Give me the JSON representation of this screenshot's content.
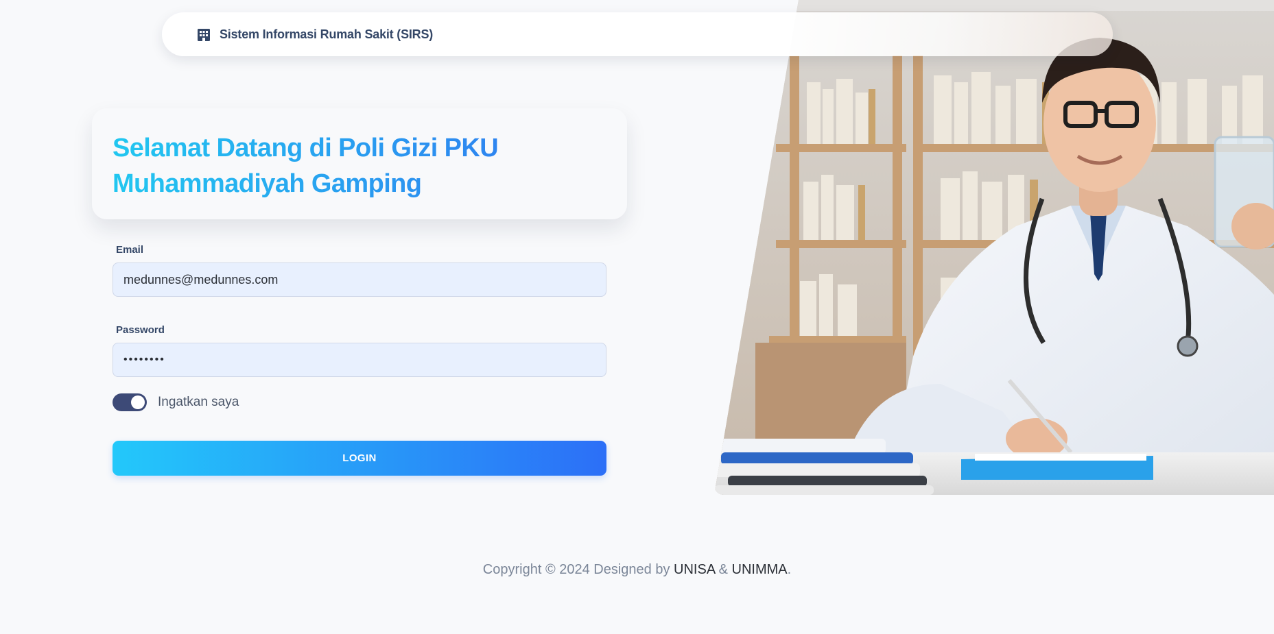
{
  "navbar": {
    "brand_text": "Sistem Informasi Rumah Sakit (SIRS)",
    "brand_icon": "hospital-building-icon"
  },
  "welcome": {
    "title": "Selamat Datang di Poli Gizi PKU Muhammadiyah Gamping"
  },
  "form": {
    "email_label": "Email",
    "email_value": "medunnes@medunnes.com",
    "password_label": "Password",
    "password_value": "••••••••",
    "remember_label": "Ingatkan saya",
    "remember_checked": true,
    "login_label": "LOGIN"
  },
  "footer": {
    "prefix": "Copyright © 2024 Designed by ",
    "org1": "UNISA",
    "separator": " & ",
    "org2": "UNIMMA",
    "suffix": "."
  },
  "colors": {
    "accent_start": "#21c7f0",
    "accent_end": "#2c6ff7",
    "toggle": "#3d4a77",
    "input_bg": "#e8f0fe"
  }
}
